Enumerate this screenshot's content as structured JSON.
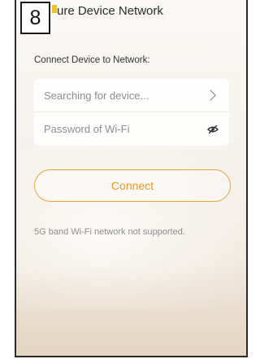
{
  "step_badge": "8",
  "header": {
    "title": "ure Device Network"
  },
  "form": {
    "section_label": "Connect Device to Network:",
    "device_field": {
      "placeholder": "Searching for device...",
      "icon": "chevron-right-icon"
    },
    "password_field": {
      "placeholder": "Password of Wi-Fi",
      "icon": "eye-slash-icon"
    }
  },
  "connect_button": {
    "label": "Connect"
  },
  "note": "5G band Wi-Fi network not supported.",
  "colors": {
    "accent": "#e69a25",
    "accent_border": "#e9a53a",
    "header_accent": "#f1c21b"
  }
}
